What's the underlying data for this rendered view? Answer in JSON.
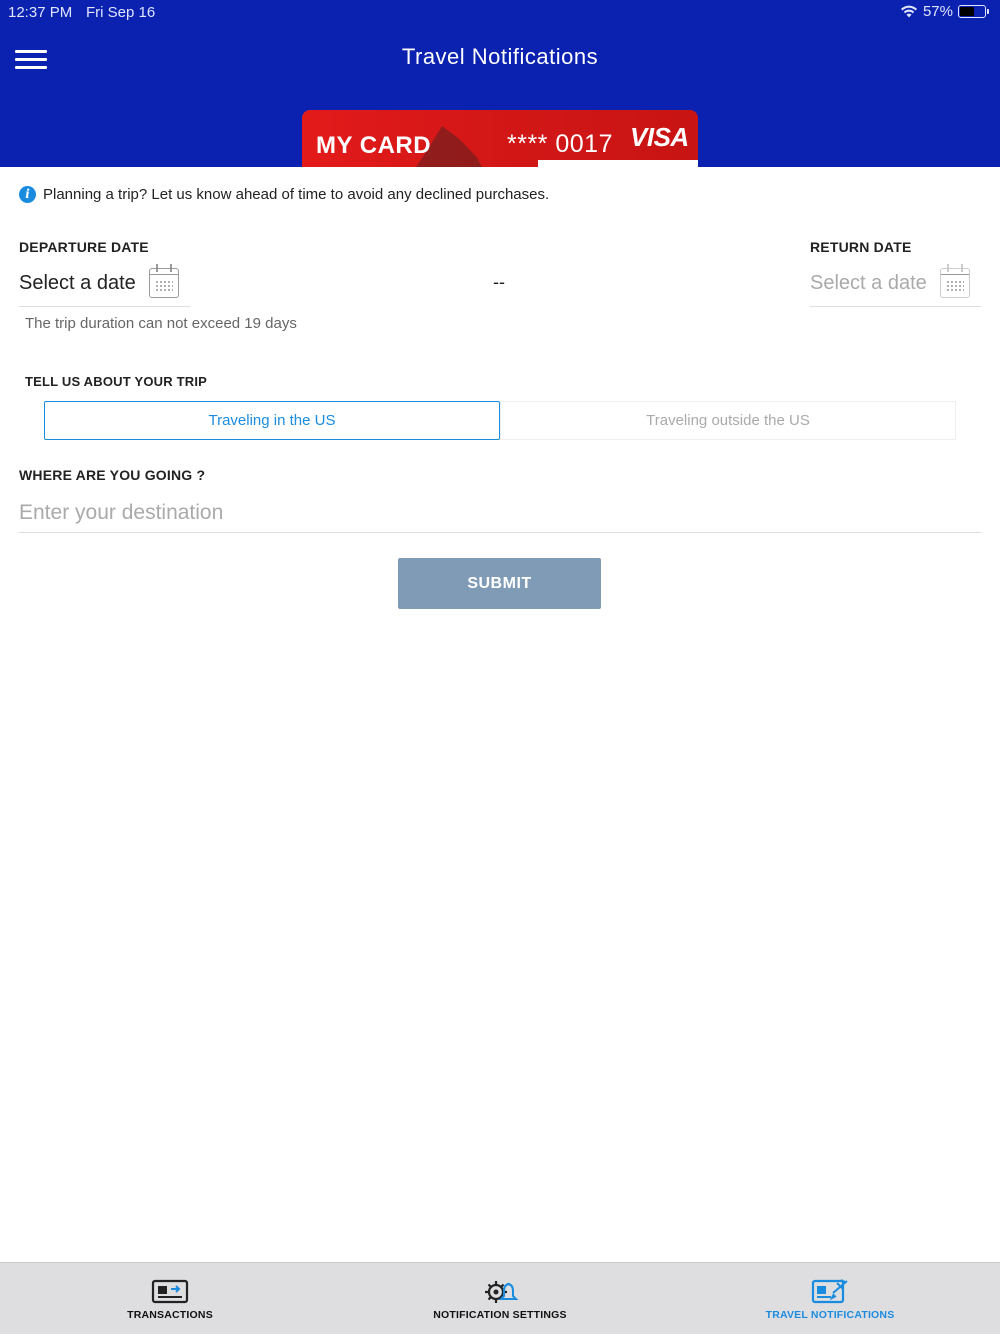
{
  "status_bar": {
    "time": "12:37 PM",
    "date": "Fri Sep 16",
    "battery": "57%",
    "battery_level": 0.57
  },
  "header": {
    "title": "Travel Notifications"
  },
  "card": {
    "name": "MY CARD",
    "number": "**** 0017",
    "brand": "VISA"
  },
  "info_message": "Planning a trip? Let us know ahead of time to avoid any declined purchases.",
  "departure": {
    "label": "DEPARTURE DATE",
    "placeholder": "Select a date"
  },
  "separator": "--",
  "return": {
    "label": "RETURN DATE",
    "placeholder": "Select a date"
  },
  "duration_hint": "The trip duration can not exceed 19 days",
  "trip": {
    "label": "TELL US ABOUT YOUR TRIP",
    "options": [
      "Traveling in the US",
      "Traveling outside the US"
    ],
    "selected": "Traveling in the US"
  },
  "destination": {
    "label": "WHERE ARE YOU GOING ?",
    "placeholder": "Enter your destination",
    "value": ""
  },
  "submit_label": "SUBMIT",
  "tabs": [
    {
      "label": "TRANSACTIONS",
      "icon": "card-transactions-icon",
      "selected": false
    },
    {
      "label": "NOTIFICATION SETTINGS",
      "icon": "gear-bell-icon",
      "selected": false
    },
    {
      "label": "TRAVEL NOTIFICATIONS",
      "icon": "card-plane-icon",
      "selected": true
    }
  ],
  "colors": {
    "header": "#0b22b0",
    "accent": "#1a8ce0",
    "card": "#d41717",
    "submit": "#809bb5",
    "tabbar": "#dedee0"
  }
}
